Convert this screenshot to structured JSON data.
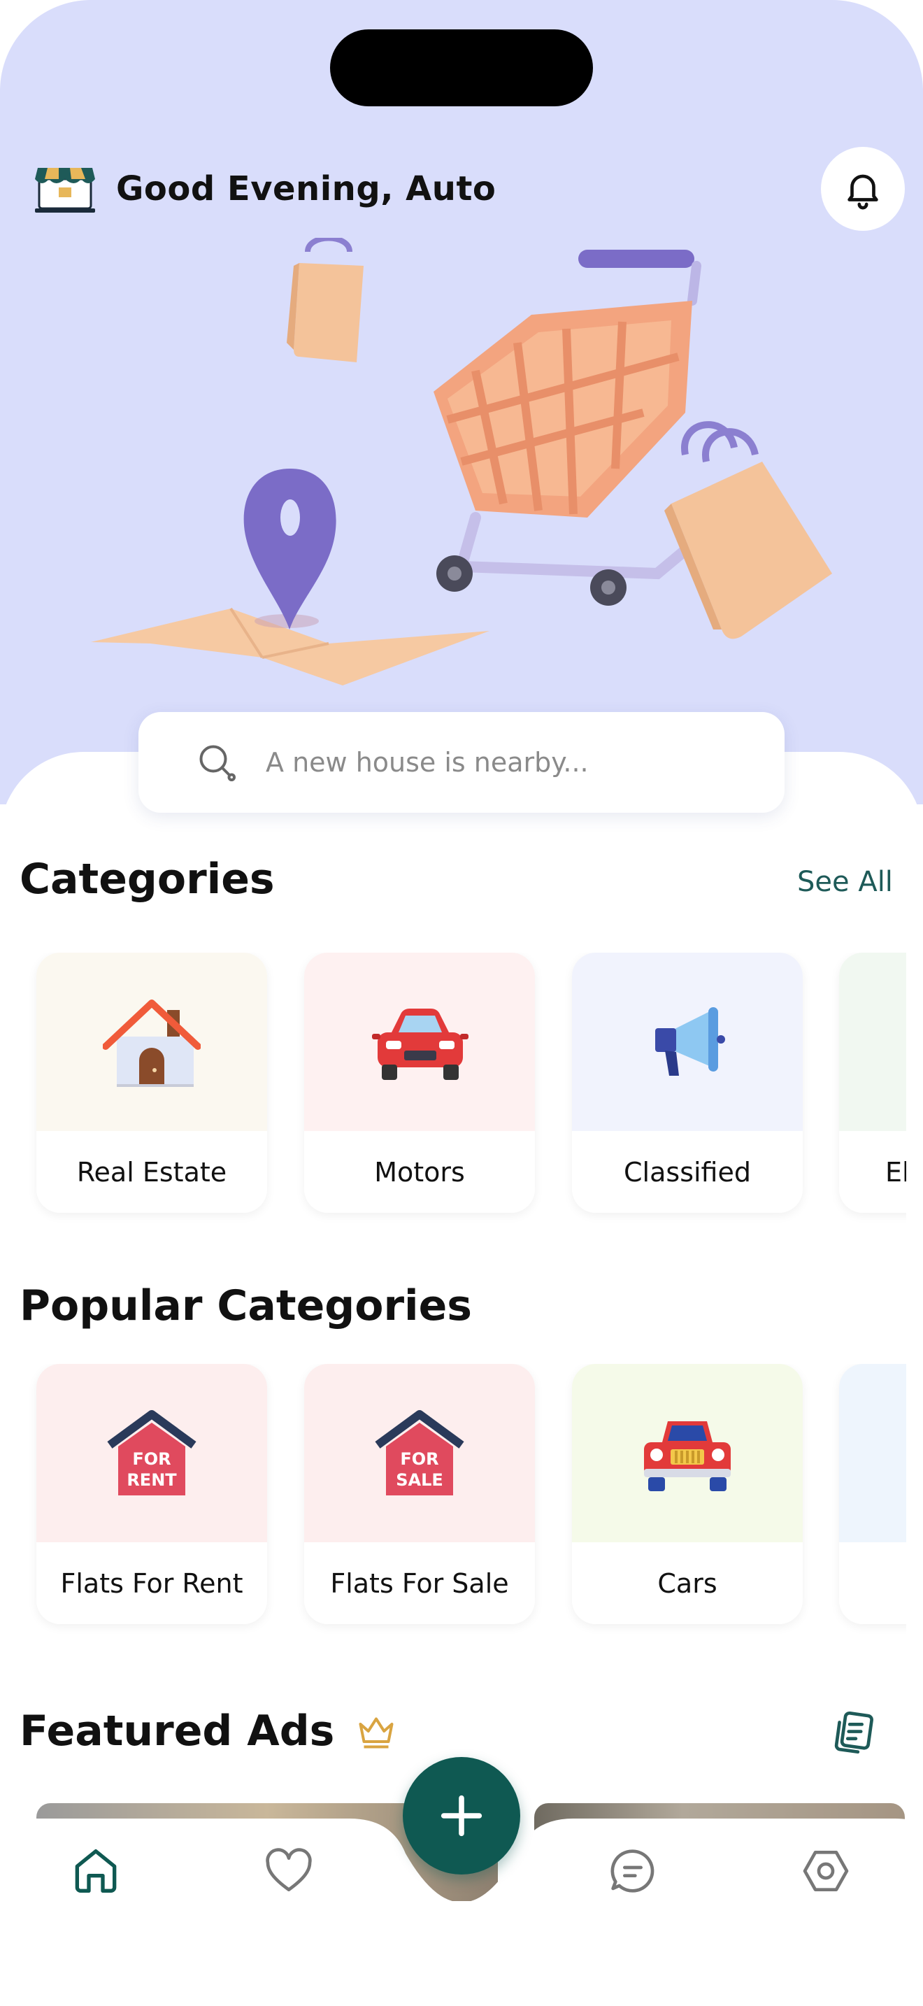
{
  "header": {
    "greeting": "Good Evening, Auto",
    "logo_icon": "storefront-logo",
    "notification_icon": "bell-icon"
  },
  "search": {
    "placeholder": "A new house is nearby...",
    "icon": "search-icon"
  },
  "categories": {
    "title": "Categories",
    "see_all": "See All",
    "items": [
      {
        "label": "Real Estate",
        "icon": "house-icon",
        "bg": "#fbf8f0"
      },
      {
        "label": "Motors",
        "icon": "car-icon",
        "bg": "#fef1f1"
      },
      {
        "label": "Classified",
        "icon": "megaphone-icon",
        "bg": "#f1f3fd"
      },
      {
        "label": "El",
        "icon": "electronics-icon",
        "bg": "#f1f8f1"
      }
    ]
  },
  "popular_categories": {
    "title": "Popular Categories",
    "items": [
      {
        "label": "Flats For Rent",
        "icon": "for-rent-icon",
        "sign": [
          "FOR",
          "RENT"
        ],
        "bg": "#fdeeee"
      },
      {
        "label": "Flats For Sale",
        "icon": "for-sale-icon",
        "sign": [
          "FOR",
          "SALE"
        ],
        "bg": "#fdeeee"
      },
      {
        "label": "Cars",
        "icon": "jeep-icon",
        "bg": "#f5fae9"
      },
      {
        "label": "",
        "icon": "generic-icon",
        "bg": "#eef5fd"
      }
    ]
  },
  "featured": {
    "title": "Featured Ads",
    "crown_icon": "crown-icon",
    "list_icon": "ads-list-icon"
  },
  "tabbar": {
    "items": [
      {
        "name": "home",
        "icon": "home-icon"
      },
      {
        "name": "favorites",
        "icon": "heart-icon"
      },
      {
        "name": "chat",
        "icon": "chat-icon"
      },
      {
        "name": "settings",
        "icon": "settings-icon"
      }
    ],
    "fab_icon": "plus-icon"
  },
  "colors": {
    "hero_bg": "#d9ddfb",
    "accent": "#0f5952",
    "link": "#1e5a58"
  }
}
